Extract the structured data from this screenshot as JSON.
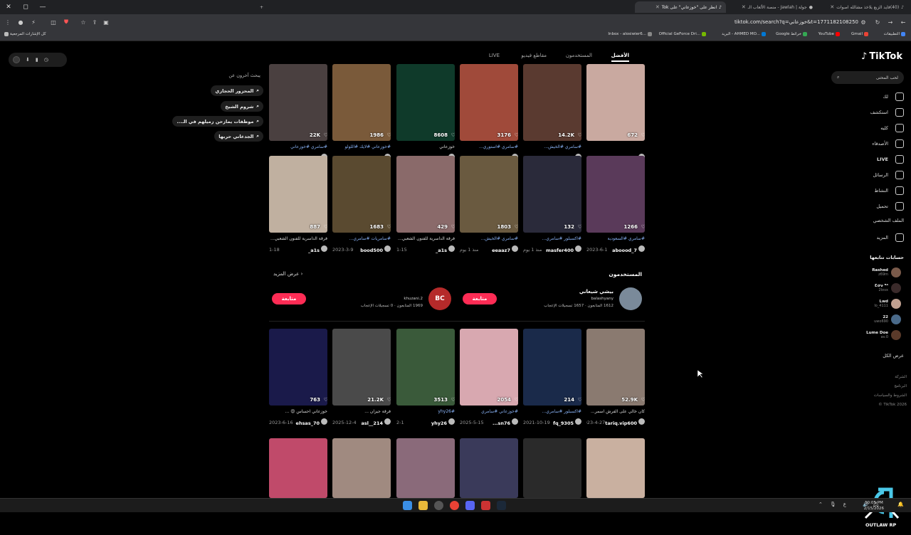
{
  "window": {
    "minimize": "—",
    "restore": "◻",
    "close": "✕",
    "new_tab": "+"
  },
  "tabs": [
    {
      "title": "(40)فايد الزبع يلاخذ مشالله اصوات",
      "active": false
    },
    {
      "title": "جولة | Jawlah - منصة الألعاب الـ",
      "active": false
    },
    {
      "title": "انظر على \"خوزعاني\" على Tok",
      "active": true
    }
  ],
  "toolbar": {
    "url": "tiktok.com/search?q=خوزعاني&t=1771182108250"
  },
  "bookmarks": [
    {
      "label": "التطبيقات",
      "color": "#4285f4"
    },
    {
      "label": "Gmail",
      "color": "#ea4335"
    },
    {
      "label": "YouTube",
      "color": "#ff0000"
    },
    {
      "label": "Google خرائط",
      "color": "#34a853"
    },
    {
      "label": "البريد - AHMED MO...",
      "color": "#0078d4"
    },
    {
      "label": "Official GeForce Dri...",
      "color": "#76b900"
    },
    {
      "label": "Inbox - alosiwier6...",
      "color": "#888888"
    },
    {
      "label": "كل الإشارات المرجعية",
      "color": "#bbbbbb"
    }
  ],
  "sidebar": {
    "logo": "TikTok",
    "search_placeholder": "لحب المحتى",
    "nav": [
      {
        "label": "لك",
        "icon": "home-icon"
      },
      {
        "label": "استكشف",
        "icon": "compass-icon"
      },
      {
        "label": "كليه",
        "icon": "friends-icon"
      },
      {
        "label": "الأصدقاء",
        "icon": "users-icon"
      },
      {
        "label": "LIVE",
        "icon": "live-icon"
      },
      {
        "label": "الرسائل",
        "icon": "send-icon"
      },
      {
        "label": "النشاط",
        "icon": "inbox-icon"
      },
      {
        "label": "تحميل",
        "icon": "upload-icon"
      },
      {
        "label": "الملف الشخصي",
        "icon": "profile-icon"
      },
      {
        "label": "المزيد",
        "icon": "more-icon"
      }
    ],
    "following_title": "حسابات تتابعها",
    "following": [
      {
        "name": "Rashed",
        "handle": "z69m"
      },
      {
        "name": "Ɛσν ᴿᴬ",
        "handle": "2lovx"
      },
      {
        "name": "Lwd",
        "handle": "lo_4111"
      },
      {
        "name": "22",
        "handle": "uwo690"
      },
      {
        "name": "Lume Doe",
        "handle": "av.0"
      }
    ],
    "show_all": "عرض الكل",
    "footer": [
      "الشركة",
      "البرنامج",
      "الشروط والسياسات",
      "TikTok 2026 ©"
    ]
  },
  "related": {
    "title": "يبحث آخرون عن",
    "items": [
      "المحزور الحجازي",
      "شروم الشيخ",
      "موظفات يمازحن زميلهم في الـ...",
      "الجدعاني حربها"
    ]
  },
  "top_tabs": [
    "الأفضل",
    "المستخدمون",
    "مقاطع فيديو",
    "LIVE"
  ],
  "row1": [
    {
      "likes": "672",
      "caption": "",
      "user": "3611061727",
      "date": "2025-11-5",
      "thumb": "#c9a9a0"
    },
    {
      "likes": "14.2K",
      "caption": "#سامري #الخيش...",
      "user": "eeaaz7",
      "date": "2025-12-12",
      "thumb": "#5a3a30"
    },
    {
      "likes": "3176",
      "caption": "#سامري #استوري...",
      "user": "riyadh4351",
      "date": "2025-2-1",
      "thumb": "#a04a3a"
    },
    {
      "likes": "8608",
      "caption": "خوزعاني",
      "user": "fooooof22",
      "date": "2025-1-17",
      "thumb": "#0f3a2a"
    },
    {
      "likes": "1986",
      "caption": "#خوزعاني #لايك #اللولو",
      "user": "kbt.5",
      "date": "2023-10-22",
      "thumb": "#7a5a3a"
    },
    {
      "likes": "22K",
      "caption": "#سامري #خوزعاني",
      "user": "bood500",
      "date": "2023-2-27",
      "thumb": "#4a4040"
    }
  ],
  "row2": [
    {
      "likes": "1266",
      "caption": "#سامري #السعودية",
      "user": "aboood_7",
      "date": "2023-6-1",
      "thumb": "#5a3a5a"
    },
    {
      "likes": "132",
      "caption": "#اكسبلور #سامري...",
      "user": "masfer400",
      "date": "منذ 1 يوم",
      "thumb": "#2a2a3a"
    },
    {
      "likes": "1803",
      "caption": "#سامري #الخيش...",
      "user": "eeaaz7",
      "date": "منذ 1 يوم",
      "thumb": "#6a5a40"
    },
    {
      "likes": "429",
      "caption": "فرقة الداسرية للفنون الشعبي...",
      "user": "a1s_",
      "date": "1-15",
      "thumb": "#8a6a6a"
    },
    {
      "likes": "1683",
      "caption": "#سامريات #سامري...",
      "user": "bood500",
      "date": "2023-3-9",
      "thumb": "#5a4a30"
    },
    {
      "likes": "887",
      "caption": "فرقة الداسرية للفنون الشعبي...",
      "user": "a1s_",
      "date": "1-18",
      "thumb": "#c0b0a0"
    }
  ],
  "users": {
    "title": "المستخدمون",
    "see_more": "عرض المزيد",
    "items": [
      {
        "name": "بيشي شيعاني",
        "handle": "balashyany",
        "followers": "1612 المتابعون",
        "likes": "1657 تسجيلات الإعجاب",
        "follow": "متابعة",
        "color": "#7a8a9a"
      },
      {
        "name": "",
        "handle": "khuzani.2",
        "followers": "1969 المتابعون",
        "likes": "0 تسجيلات الإعجاب",
        "follow": "متابعة",
        "color": "#b52a2a",
        "badge": "BC"
      }
    ]
  },
  "row3": [
    {
      "likes": "52.9K",
      "caption": "كان خالي على الفرش اسمر...",
      "user": "tariq.vip600",
      "date": "2023-4-27",
      "thumb": "#8a7a70"
    },
    {
      "likes": "214",
      "caption": "#اكسبلور #سامري...",
      "user": "fq_9305",
      "date": "2021-10-19",
      "thumb": "#1a2a4a"
    },
    {
      "likes": "2054",
      "caption": "#خوزعاني #سامري",
      "user": "sn76...",
      "date": "2025-5-15",
      "thumb": "#d8a8b0"
    },
    {
      "likes": "3513",
      "caption": "#yhy26",
      "user": "yhy26",
      "date": "2-1",
      "thumb": "#3a5a3a"
    },
    {
      "likes": "21.2K",
      "caption": "فرقة جيزان ...",
      "user": "asl__214",
      "date": "2025-12-4",
      "thumb": "#4a4a4a"
    },
    {
      "likes": "763",
      "caption": "خوزعاني احساس 😍 ...",
      "user": "ehsas_70",
      "date": "2023-6-16",
      "thumb": "#1a1a4a"
    }
  ],
  "row4": [
    {
      "thumb": "#c9b0a0"
    },
    {
      "thumb": "#2a2a2a"
    },
    {
      "thumb": "#3a3a5a"
    },
    {
      "thumb": "#8a6a7a"
    },
    {
      "thumb": "#a08a80"
    },
    {
      "thumb": "#c04a6a"
    }
  ],
  "extension": {
    "icons": [
      "◼",
      "⬇",
      "▮",
      "◷"
    ]
  },
  "taskbar": {
    "time": "10:05 PM",
    "date": "2/15/2026"
  },
  "watermark": {
    "text": "OUTLAW RP"
  }
}
